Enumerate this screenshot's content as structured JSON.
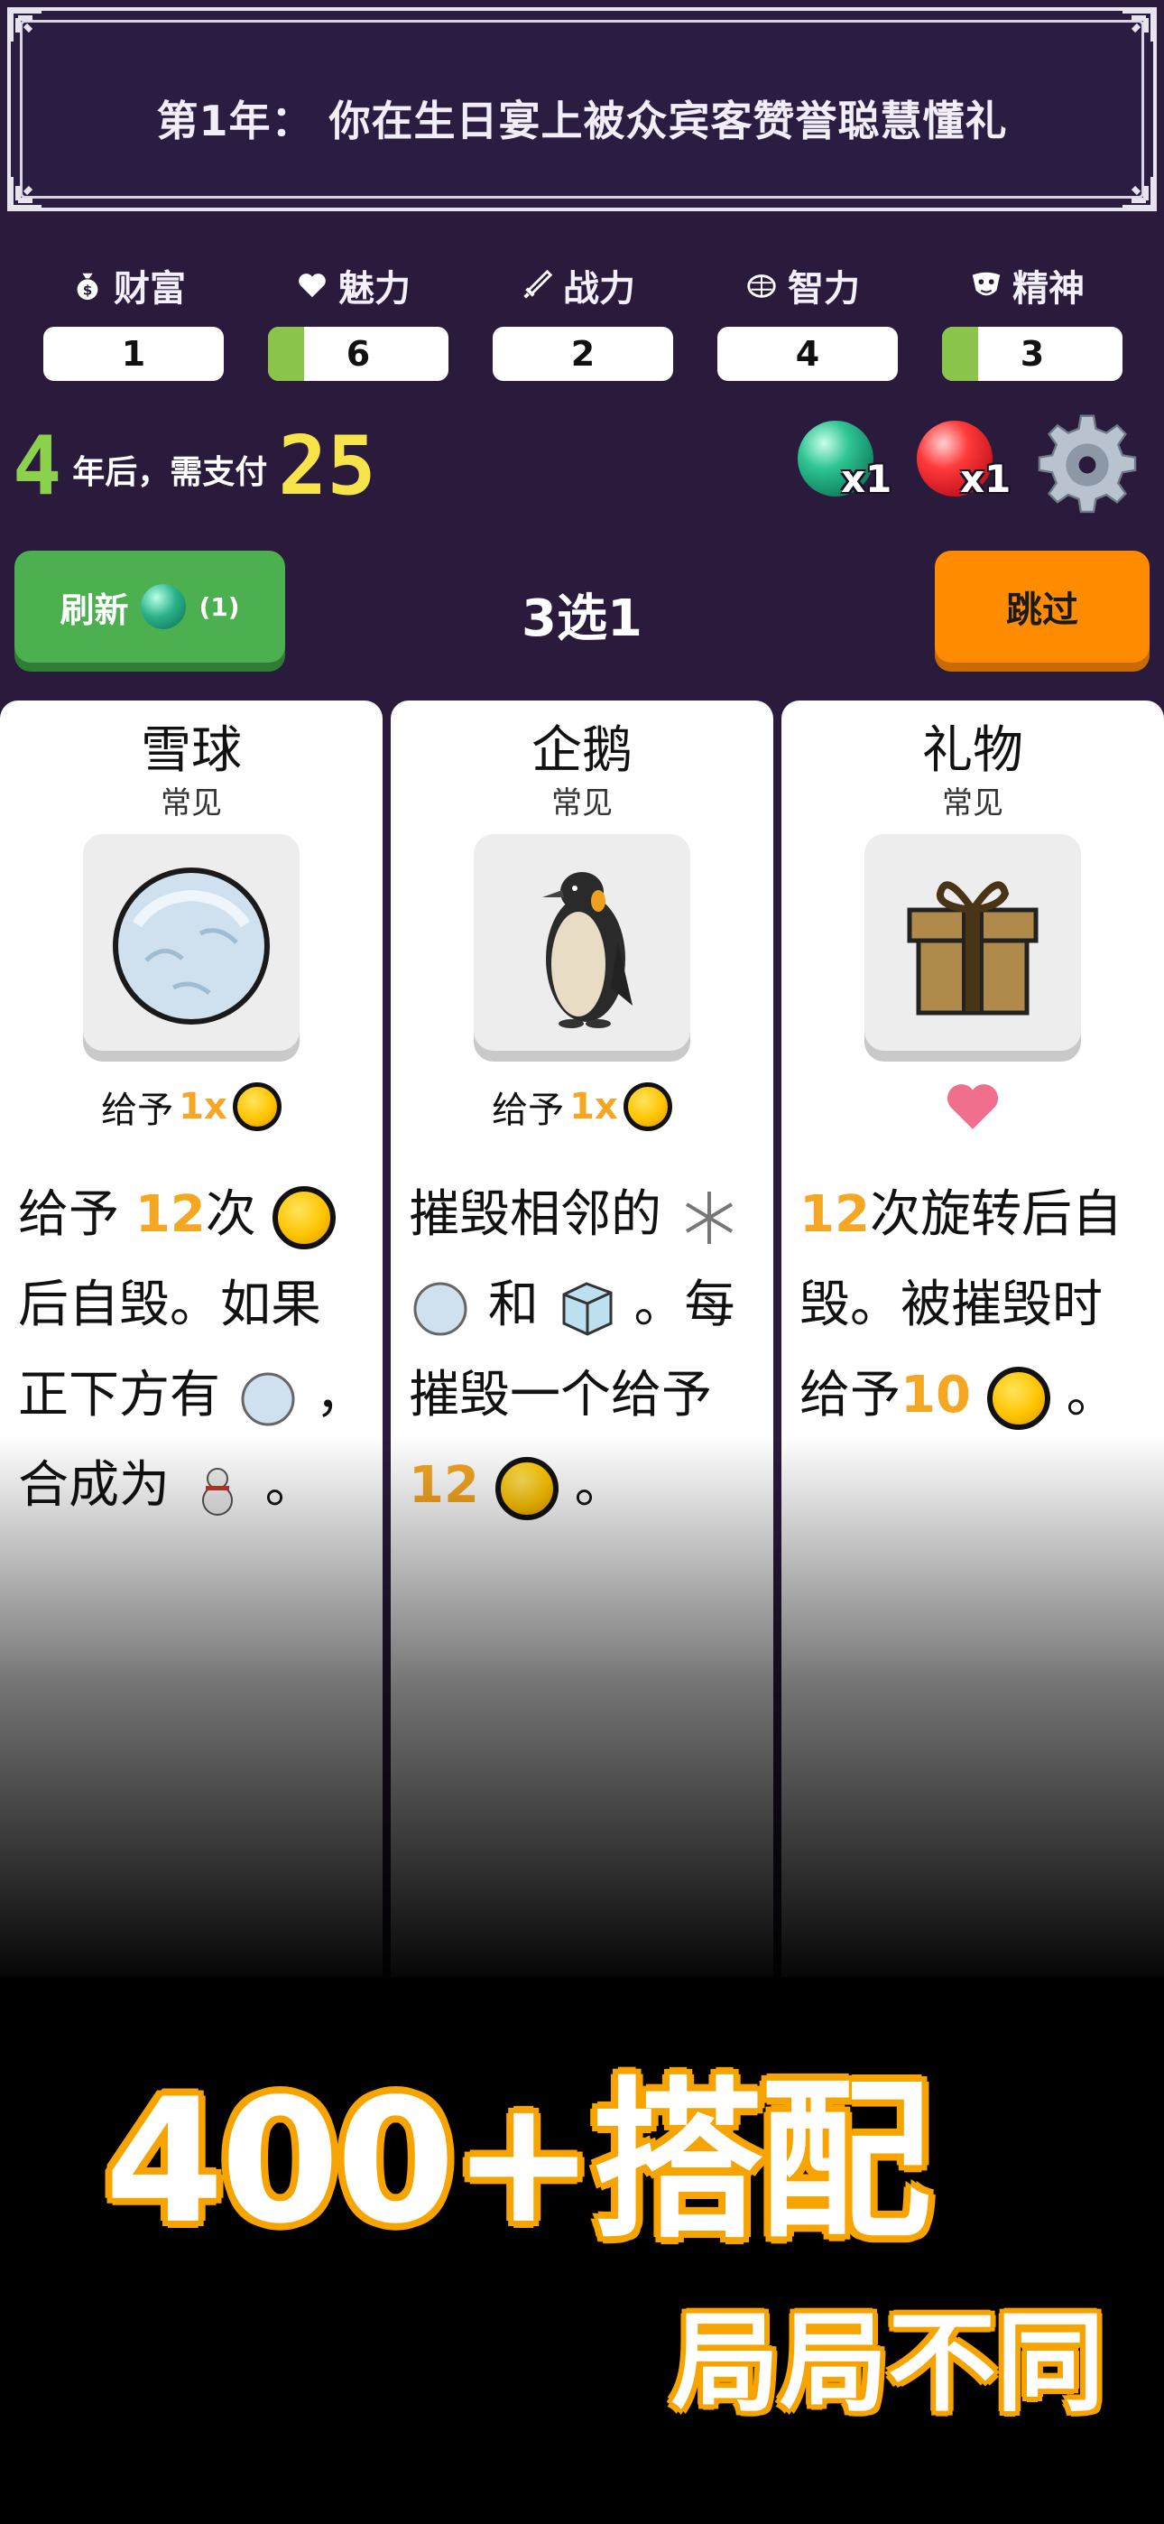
{
  "event": {
    "text": "第1年：  你在生日宴上被众宾客赞誉聪慧懂礼"
  },
  "stats": [
    {
      "label": "财富",
      "icon": "money-bag-icon",
      "value": "1",
      "fill": 0
    },
    {
      "label": "魅力",
      "icon": "heart-icon",
      "value": "6",
      "fill": 0.2
    },
    {
      "label": "战力",
      "icon": "sword-icon",
      "value": "2",
      "fill": 0
    },
    {
      "label": "智力",
      "icon": "brain-icon",
      "value": "4",
      "fill": 0
    },
    {
      "label": "精神",
      "icon": "mask-icon",
      "value": "3",
      "fill": 0.2
    }
  ],
  "rent": {
    "years": "4",
    "text": "年后，需支付",
    "amount": "25"
  },
  "orbs": [
    {
      "name": "green-orb",
      "count": "x1",
      "color": "#1fa878"
    },
    {
      "name": "red-orb",
      "count": "x1",
      "color": "#e0202a"
    }
  ],
  "actions": {
    "refresh_label": "刷新",
    "refresh_count": "(1)",
    "pick_title": "3选1",
    "skip_label": "跳过"
  },
  "cards": [
    {
      "title": "雪球",
      "rarity": "常见",
      "give_prefix": "给予",
      "give_amount": "1x",
      "desc": {
        "p1": "给予 ",
        "n1": "12",
        "p2": "次",
        "p3": "后自毁。如果正下方有",
        "p4": "，合成为",
        "p5": "。"
      }
    },
    {
      "title": "企鹅",
      "rarity": "常见",
      "give_prefix": "给予",
      "give_amount": "1x",
      "desc": {
        "p1": "摧毁相邻的",
        "p2": "和",
        "p3": "。每摧毁一个给予",
        "n1": "12",
        "p4": "。"
      }
    },
    {
      "title": "礼物",
      "rarity": "常见",
      "desc": {
        "n1": "12",
        "p1": "次旋转后自毁。被摧毁时给予",
        "n2": "10",
        "p2": "。"
      }
    }
  ],
  "promo": {
    "line1": "400+搭配",
    "line2": "局局不同"
  },
  "colors": {
    "background": "#2a1a3c",
    "accent_orange": "#ff8c00",
    "accent_green": "#4caf50",
    "highlight": "#f5a623",
    "rent_years": "#8cd14b",
    "rent_amount": "#f7e34a"
  }
}
